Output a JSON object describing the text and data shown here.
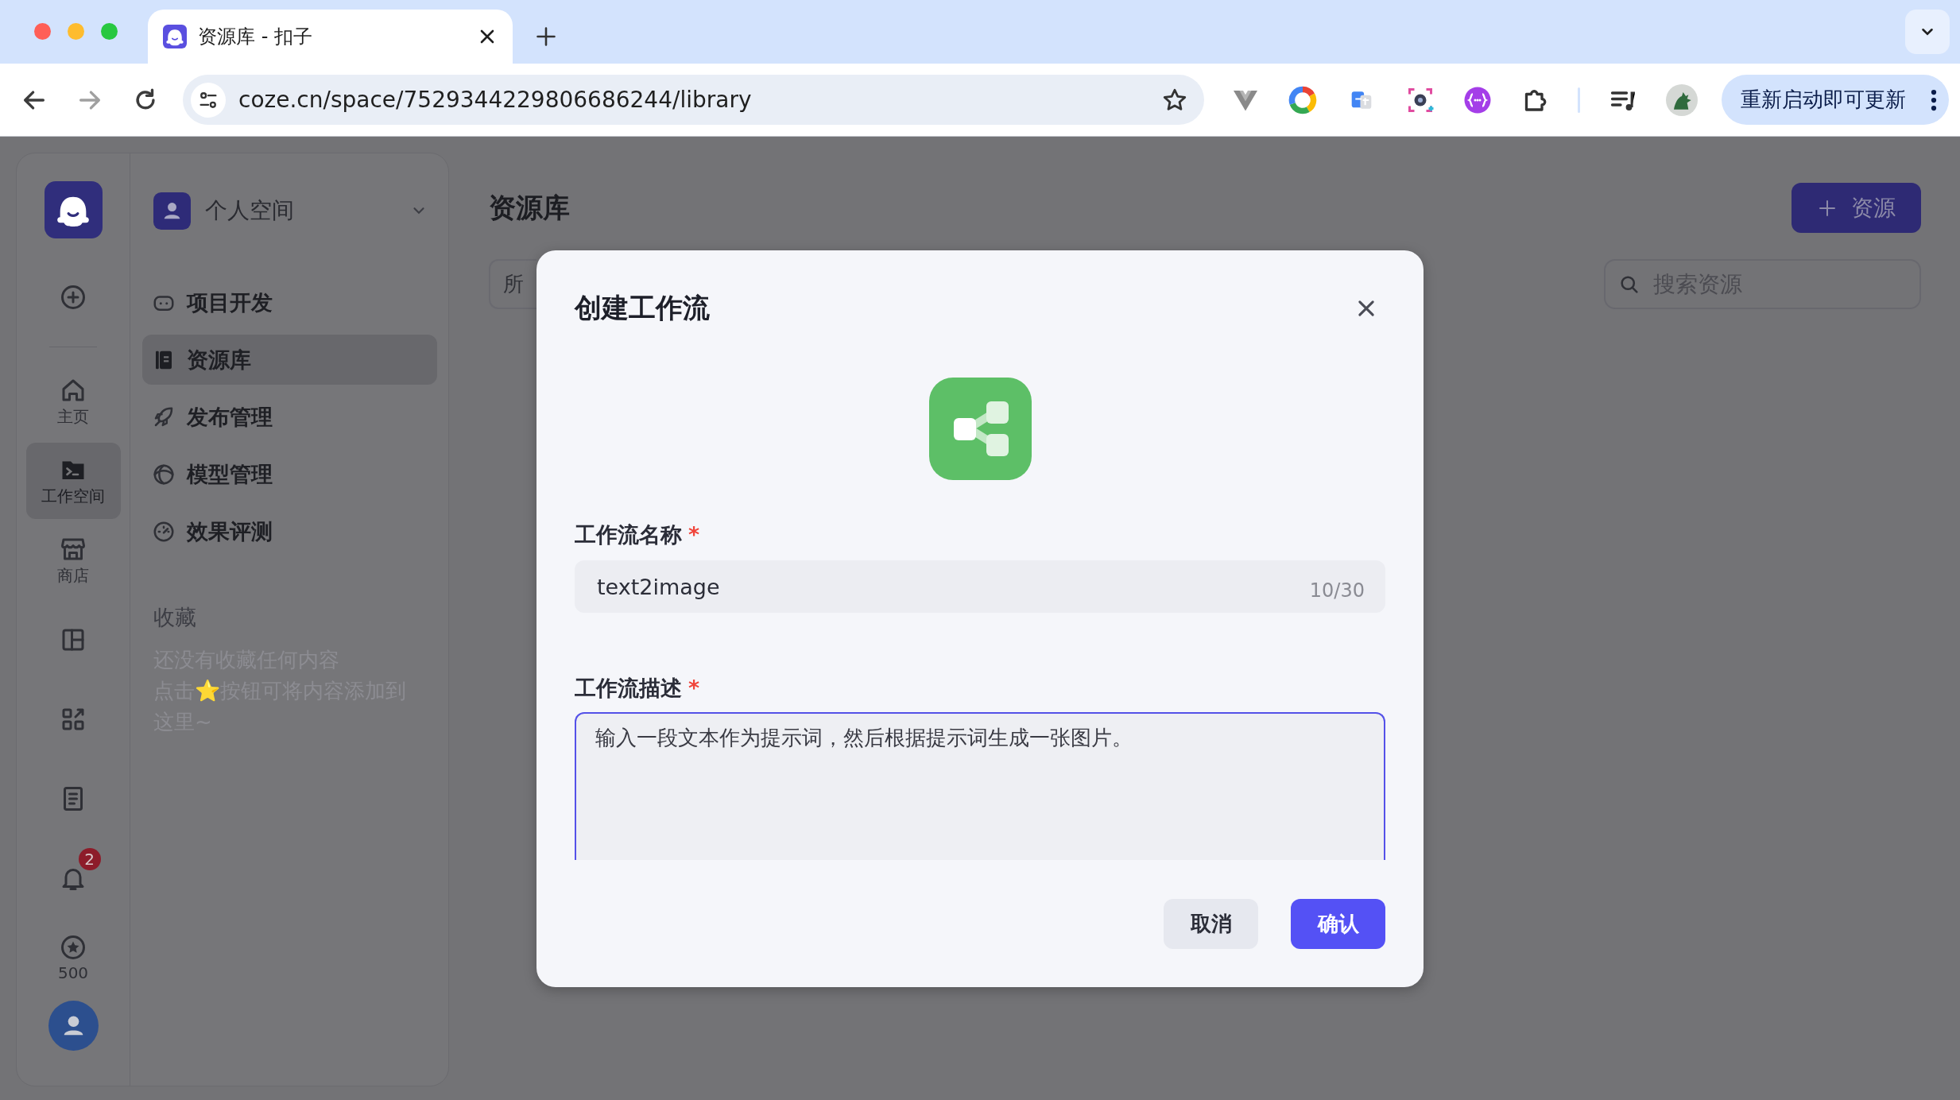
{
  "browser": {
    "tab": {
      "title": "资源库 - 扣子"
    },
    "url": "coze.cn/space/7529344229806686244/library",
    "update_button": "重新启动即可更新"
  },
  "rail": {
    "items": [
      {
        "selected": false
      },
      {
        "label": "主页",
        "selected": false
      },
      {
        "label": "工作空间",
        "selected": true
      },
      {
        "label": "商店",
        "selected": false
      },
      {
        "selected": false
      },
      {
        "selected": false
      },
      {
        "selected": false
      },
      {
        "selected": false,
        "badge": "2"
      },
      {
        "label": "500",
        "selected": false
      }
    ]
  },
  "sidebar": {
    "workspace": "个人空间",
    "menu": [
      {
        "label": "项目开发",
        "selected": false
      },
      {
        "label": "资源库",
        "selected": true
      },
      {
        "label": "发布管理",
        "selected": false
      },
      {
        "label": "模型管理",
        "selected": false
      },
      {
        "label": "效果评测",
        "selected": false
      }
    ],
    "favorites": {
      "title": "收藏",
      "lines": [
        "还没有收藏任何内容",
        "点击⭐按钮可将内容添加到这里~"
      ]
    }
  },
  "main": {
    "title": "资源库",
    "add_button": "资源",
    "filter": "所",
    "search": {
      "placeholder": "搜索资源"
    }
  },
  "dialog": {
    "title": "创建工作流",
    "fields": [
      {
        "kind": "input",
        "label": "工作流名称",
        "required_mark": "*",
        "value": "text2image",
        "counter": "10/30",
        "focused": false
      },
      {
        "kind": "textarea",
        "label": "工作流描述",
        "required_mark": "*",
        "value": "输入一段文本作为提示词，然后根据提示词生成一张图片。",
        "focused": true
      }
    ],
    "buttons": [
      {
        "label": "取消",
        "primary": false
      },
      {
        "label": "确认",
        "primary": true
      }
    ]
  }
}
